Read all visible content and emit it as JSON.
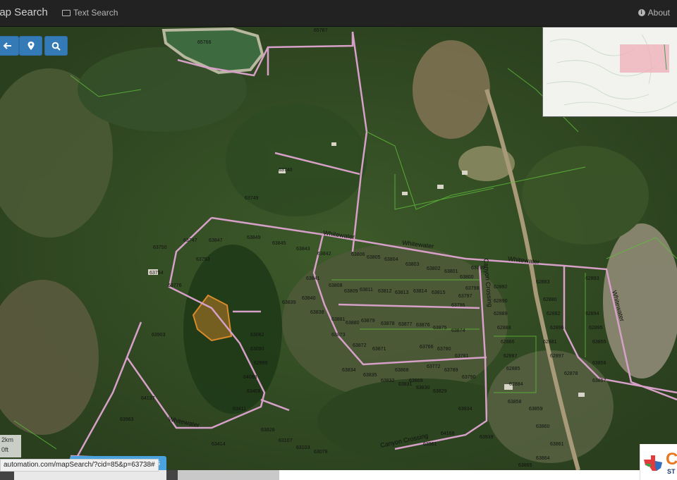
{
  "header": {
    "brand": "lap Search",
    "text_search_label": "Text Search",
    "about_label": "About"
  },
  "tools": [
    {
      "name": "back-arrow-icon"
    },
    {
      "name": "location-pin-icon"
    },
    {
      "name": "search-icon"
    }
  ],
  "map": {
    "roads": [
      "Whitewater",
      "Whitewater",
      "Whitewater",
      "Whitewater",
      "Whitewater",
      "Canyon Crossing",
      "Canyon Crossing"
    ],
    "parcels": [
      "65766",
      "65787",
      "63740",
      "63749",
      "63747",
      "63750",
      "63753",
      "63754",
      "63776",
      "63847",
      "63849",
      "63845",
      "63843",
      "63842",
      "63841",
      "63840",
      "63839",
      "63838",
      "63808",
      "63809",
      "63811",
      "63812",
      "63813",
      "63814",
      "63815",
      "63806",
      "63805",
      "63804",
      "63803",
      "63802",
      "63801",
      "63800",
      "63799",
      "63798",
      "63797",
      "63796",
      "63881",
      "63880",
      "63879",
      "63878",
      "63877",
      "63876",
      "63875",
      "63874",
      "63873",
      "63872",
      "63871",
      "62892",
      "62890",
      "62889",
      "62888",
      "62886",
      "62887",
      "62885",
      "62884",
      "62883",
      "62880",
      "62882",
      "62896",
      "62881",
      "62897",
      "62878",
      "62893",
      "62894",
      "62895",
      "63855",
      "63856",
      "63857",
      "63858",
      "63859",
      "63860",
      "63861",
      "63864",
      "63865",
      "63868",
      "63869",
      "63766",
      "63780",
      "63781",
      "63772",
      "63789",
      "63790",
      "63834",
      "63835",
      "63832",
      "63831",
      "63830",
      "63829",
      "63828",
      "63107",
      "63103",
      "63079",
      "63082",
      "63090",
      "62899",
      "64088",
      "63408",
      "63411",
      "63414",
      "64137",
      "63963",
      "63961",
      "64168",
      "63939",
      "63934",
      "63903",
      "63908",
      "63921",
      "63910",
      "63906",
      "63900",
      "63899",
      "63898"
    ],
    "highlighted_parcel_color": "#d98a2b",
    "road_color": "#d7a0c8",
    "overview_extent_color": "#f0a9b4"
  },
  "status": {
    "scale_km": "2km",
    "scale_ft": "0ft",
    "url_tooltip": "automation.com/mapSearch/?cid=85&p=63738#",
    "results_button_label": "sults"
  },
  "logo": {
    "letter": "C",
    "subtitle": "ST"
  }
}
